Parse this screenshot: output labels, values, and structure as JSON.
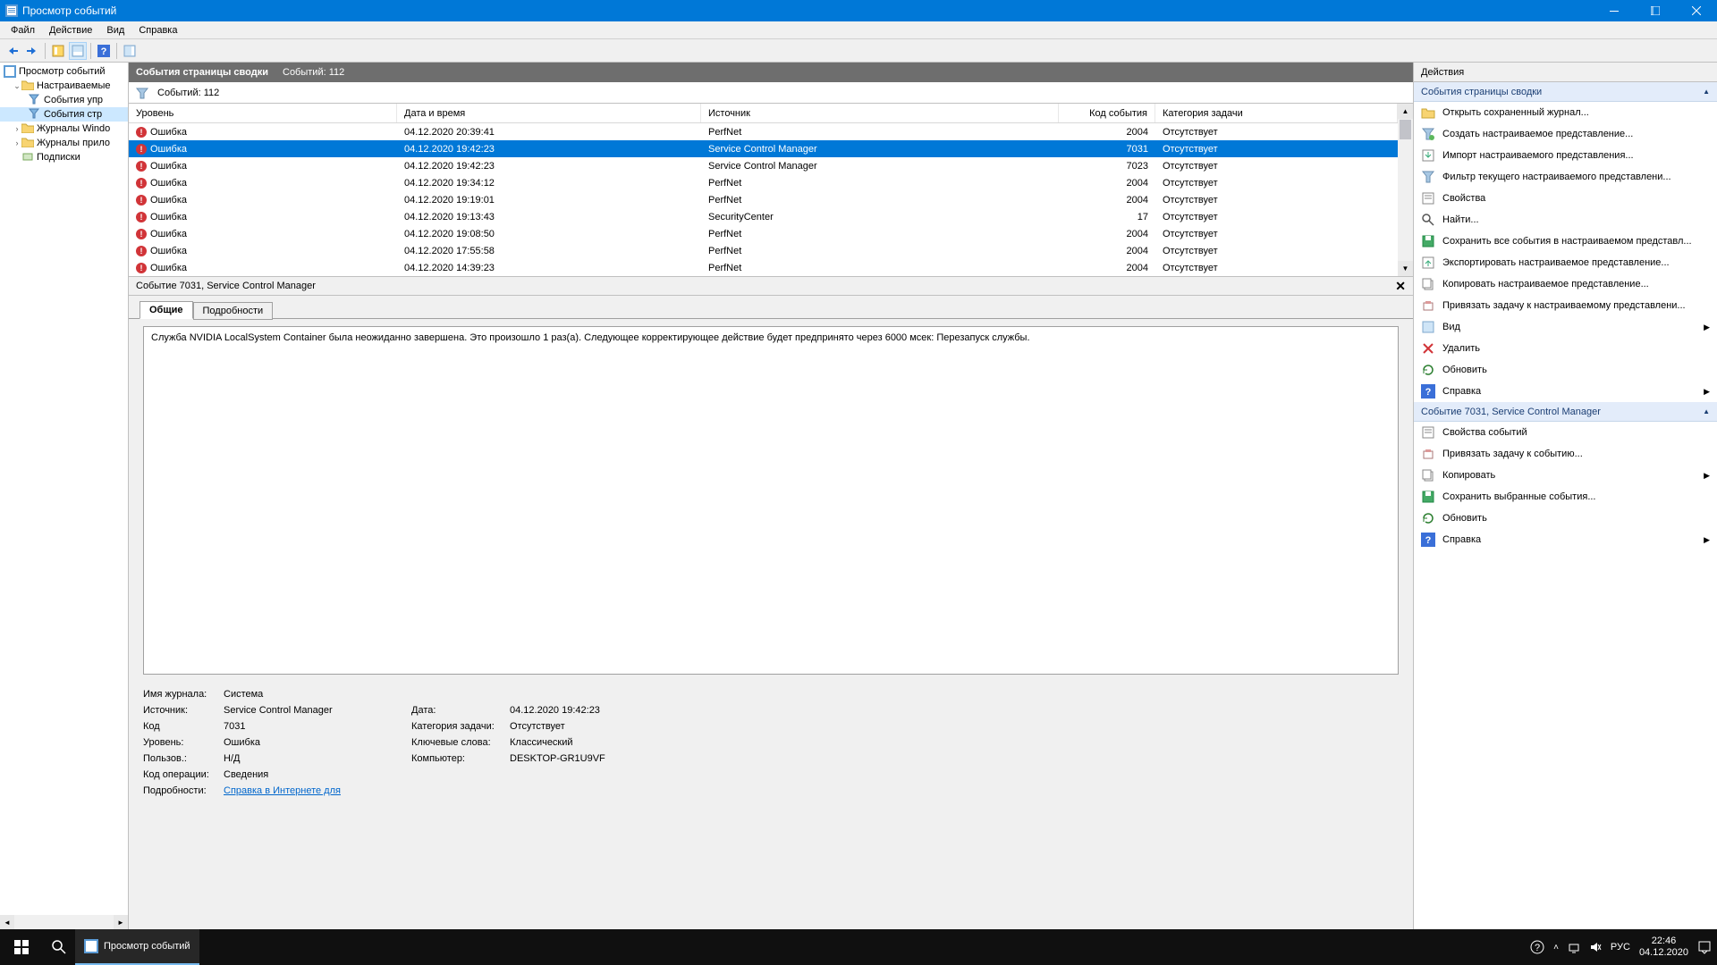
{
  "title": "Просмотр событий",
  "menu": {
    "file": "Файл",
    "action": "Действие",
    "view": "Вид",
    "help": "Справка"
  },
  "tree": {
    "root": "Просмотр событий",
    "custom": "Настраиваемые",
    "admin": "События упр",
    "summary": "События стр",
    "winlogs": "Журналы Windo",
    "applogs": "Журналы прило",
    "subs": "Подписки"
  },
  "headbar": {
    "title": "События страницы сводки",
    "count": "Событий: 112"
  },
  "filter": {
    "count": "Событий: 112"
  },
  "columns": {
    "level": "Уровень",
    "datetime": "Дата и время",
    "source": "Источник",
    "code": "Код события",
    "category": "Категория задачи"
  },
  "rows": [
    {
      "level": "Ошибка",
      "dt": "04.12.2020 20:39:41",
      "src": "PerfNet",
      "code": "2004",
      "cat": "Отсутствует",
      "sel": false
    },
    {
      "level": "Ошибка",
      "dt": "04.12.2020 19:42:23",
      "src": "Service Control Manager",
      "code": "7031",
      "cat": "Отсутствует",
      "sel": true
    },
    {
      "level": "Ошибка",
      "dt": "04.12.2020 19:42:23",
      "src": "Service Control Manager",
      "code": "7023",
      "cat": "Отсутствует",
      "sel": false
    },
    {
      "level": "Ошибка",
      "dt": "04.12.2020 19:34:12",
      "src": "PerfNet",
      "code": "2004",
      "cat": "Отсутствует",
      "sel": false
    },
    {
      "level": "Ошибка",
      "dt": "04.12.2020 19:19:01",
      "src": "PerfNet",
      "code": "2004",
      "cat": "Отсутствует",
      "sel": false
    },
    {
      "level": "Ошибка",
      "dt": "04.12.2020 19:13:43",
      "src": "SecurityCenter",
      "code": "17",
      "cat": "Отсутствует",
      "sel": false
    },
    {
      "level": "Ошибка",
      "dt": "04.12.2020 19:08:50",
      "src": "PerfNet",
      "code": "2004",
      "cat": "Отсутствует",
      "sel": false
    },
    {
      "level": "Ошибка",
      "dt": "04.12.2020 17:55:58",
      "src": "PerfNet",
      "code": "2004",
      "cat": "Отсутствует",
      "sel": false
    },
    {
      "level": "Ошибка",
      "dt": "04.12.2020 14:39:23",
      "src": "PerfNet",
      "code": "2004",
      "cat": "Отсутствует",
      "sel": false
    }
  ],
  "detail": {
    "header": "Событие 7031, Service Control Manager",
    "tab_general": "Общие",
    "tab_details": "Подробности",
    "desc": "Служба NVIDIA LocalSystem Container была неожиданно завершена. Это произошло 1 раз(а). Следующее корректирующее действие будет предпринято через 6000 мсек: Перезапуск службы.",
    "labels": {
      "logname": "Имя журнала:",
      "source": "Источник:",
      "date": "Дата:",
      "code": "Код",
      "category": "Категория задачи:",
      "level": "Уровень:",
      "keywords": "Ключевые слова:",
      "user": "Пользов.:",
      "computer": "Компьютер:",
      "opcode": "Код операции:",
      "moreinfo": "Подробности:"
    },
    "values": {
      "logname": "Система",
      "source": "Service Control Manager",
      "date": "04.12.2020 19:42:23",
      "code": "7031",
      "category": "Отсутствует",
      "level": "Ошибка",
      "keywords": "Классический",
      "user": "Н/Д",
      "computer": "DESKTOP-GR1U9VF",
      "opcode": "Сведения",
      "moreinfo": "Справка в Интернете для "
    }
  },
  "actions": {
    "title": "Действия",
    "section1": "События страницы сводки",
    "items1": [
      {
        "i": "open",
        "t": "Открыть сохраненный журнал..."
      },
      {
        "i": "funnel-new",
        "t": "Создать настраиваемое представление..."
      },
      {
        "i": "import",
        "t": "Импорт настраиваемого представления..."
      },
      {
        "i": "funnel",
        "t": "Фильтр текущего настраиваемого представлени..."
      },
      {
        "i": "props",
        "t": "Свойства"
      },
      {
        "i": "find",
        "t": "Найти..."
      },
      {
        "i": "save",
        "t": "Сохранить все события в настраиваемом представл..."
      },
      {
        "i": "export",
        "t": "Экспортировать настраиваемое представление..."
      },
      {
        "i": "copy",
        "t": "Копировать настраиваемое представление..."
      },
      {
        "i": "attach",
        "t": "Привязать задачу к настраиваемому представлени..."
      },
      {
        "i": "view",
        "t": "Вид",
        "sub": true
      },
      {
        "i": "delete",
        "t": "Удалить"
      },
      {
        "i": "refresh",
        "t": "Обновить"
      },
      {
        "i": "help",
        "t": "Справка",
        "sub": true
      }
    ],
    "section2": "Событие 7031, Service Control Manager",
    "items2": [
      {
        "i": "props",
        "t": "Свойства событий"
      },
      {
        "i": "attach",
        "t": "Привязать задачу к событию..."
      },
      {
        "i": "copy2",
        "t": "Копировать",
        "sub": true
      },
      {
        "i": "save",
        "t": "Сохранить выбранные события..."
      },
      {
        "i": "refresh",
        "t": "Обновить"
      },
      {
        "i": "help",
        "t": "Справка",
        "sub": true
      }
    ]
  },
  "taskbar": {
    "app": "Просмотр событий",
    "lang": "РУС",
    "time": "22:46",
    "date": "04.12.2020"
  }
}
